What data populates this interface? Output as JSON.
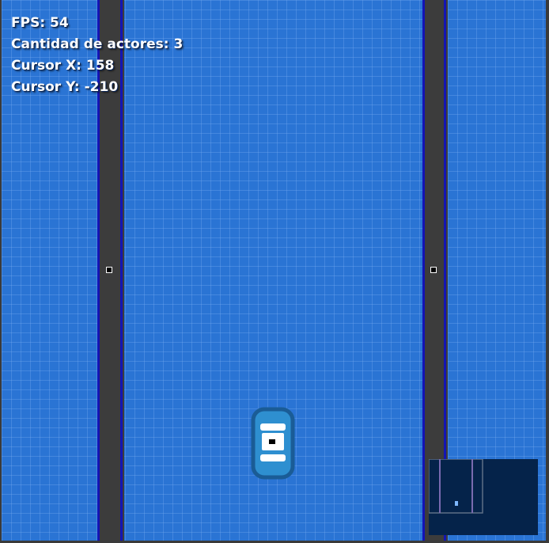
{
  "hud": {
    "fps_label": "FPS:",
    "fps_value": "54",
    "actors_label": "Cantidad de actores:",
    "actors_value": "3",
    "cursor_x_label": "Cursor X:",
    "cursor_x_value": "158",
    "cursor_y_label": "Cursor Y:",
    "cursor_y_value": "-210"
  },
  "colors": {
    "floor": "#2a74d4",
    "wall": "#3c3c3c",
    "wall_edge": "#1414b4",
    "minimap_bg": "#05234a",
    "car_body": "#2e8fd0"
  },
  "sprites": {
    "player": "car-sprite",
    "minimap": "minimap"
  }
}
